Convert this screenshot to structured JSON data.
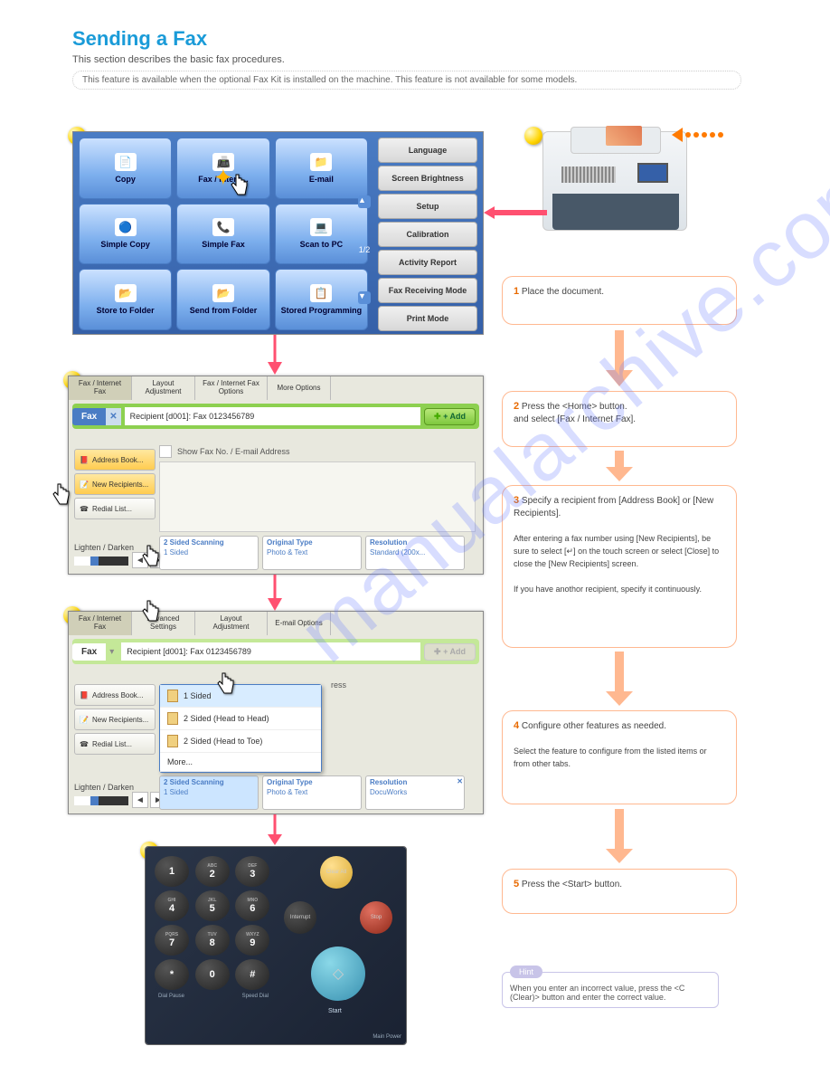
{
  "header": {
    "title": "Sending a Fax",
    "subtitle": "This section describes the basic fax procedures.",
    "note": "This feature is available when the optional Fax Kit is installed on the machine. This feature is not available for some models."
  },
  "home": {
    "tiles": [
      {
        "label": "Copy",
        "emoji": "📄"
      },
      {
        "label": "Fax / Intern...",
        "emoji": "📠"
      },
      {
        "label": "E-mail",
        "emoji": "📁"
      },
      {
        "label": "Simple Copy",
        "emoji": "🔵"
      },
      {
        "label": "Simple Fax",
        "emoji": "📞"
      },
      {
        "label": "Scan to PC",
        "emoji": "💻"
      },
      {
        "label": "Store to Folder",
        "emoji": "📂"
      },
      {
        "label": "Send from Folder",
        "emoji": "📂"
      },
      {
        "label": "Stored Programming",
        "emoji": "📋"
      }
    ],
    "right": [
      "Language",
      "Screen Brightness",
      "Setup",
      "Calibration",
      "Activity Report",
      "Fax Receiving Mode",
      "Print Mode"
    ],
    "pager": "1/2"
  },
  "fax2": {
    "tabs": [
      "Fax / Internet Fax",
      "Layout Adjustment",
      "Fax / Internet Fax Options",
      "More Options"
    ],
    "mode": "Fax",
    "recipient": "Recipient [d001]: Fax 0123456789",
    "add": "+ Add",
    "left": [
      "Address Book...",
      "New Recipients...",
      "Redial List..."
    ],
    "show": "Show Fax No. / E-mail Address",
    "lighten": "Lighten / Darken",
    "opts": [
      {
        "t": "2 Sided Scanning",
        "v": "1 Sided"
      },
      {
        "t": "Original Type",
        "v": "Photo & Text"
      },
      {
        "t": "Resolution",
        "v": "Standard (200x..."
      }
    ]
  },
  "fax3": {
    "tabs": [
      "Fax / Internet Fax",
      "Advanced Settings",
      "Layout Adjustment",
      "E-mail Options"
    ],
    "recipient": "Recipient [d001]: Fax 0123456789",
    "add": "+ Add",
    "popup": [
      "1 Sided",
      "2 Sided (Head to Head)",
      "2 Sided (Head to Toe)",
      "More..."
    ],
    "opts": [
      {
        "t": "2 Sided Scanning",
        "v": "1 Sided"
      },
      {
        "t": "Original Type",
        "v": "Photo & Text"
      },
      {
        "t": "Resolution",
        "v": "DocuWorks"
      }
    ],
    "show_partial": "ress"
  },
  "panel": {
    "keys": [
      {
        "n": "1",
        "s": ""
      },
      {
        "n": "2",
        "s": "ABC"
      },
      {
        "n": "3",
        "s": "DEF"
      },
      {
        "n": "4",
        "s": "GHI"
      },
      {
        "n": "5",
        "s": "JKL"
      },
      {
        "n": "6",
        "s": "MNO"
      },
      {
        "n": "7",
        "s": "PQRS"
      },
      {
        "n": "8",
        "s": "TUV"
      },
      {
        "n": "9",
        "s": "WXYZ"
      },
      {
        "n": "*",
        "s": ""
      },
      {
        "n": "0",
        "s": ""
      },
      {
        "n": "#",
        "s": ""
      }
    ],
    "dialpause": "Dial Pause",
    "speeddial": "Speed Dial",
    "clearall": "Clear All",
    "interrupt": "Interrupt",
    "stop": "Stop",
    "start": "Start",
    "mainpower": "Main Power"
  },
  "steps": {
    "s1": {
      "n": "1",
      "t": "Place the document."
    },
    "s2": {
      "n": "2",
      "t": "Press the <Home> button.",
      "extra": "and select [Fax / Internet Fax]."
    },
    "s3": {
      "n": "3",
      "t": "Specify a recipient from [Address Book] or [New Recipients].",
      "sub": "After entering a fax number using [New Recipients], be sure to select [↵] on the touch screen or select [Close] to close the [New Recipients] screen.",
      "note": "If you have anothor recipient, specify it continuously."
    },
    "s4": {
      "n": "4",
      "t": "Configure other features as needed.",
      "sub": "Select the feature to configure from the listed items or from other tabs."
    },
    "s5": {
      "n": "5",
      "t": "Press the <Start> button."
    }
  },
  "hint": {
    "label": "Hint",
    "text": "When you enter an incorrect value, press the <C (Clear)> button and enter the correct value."
  },
  "watermark": "manualarchive.com"
}
